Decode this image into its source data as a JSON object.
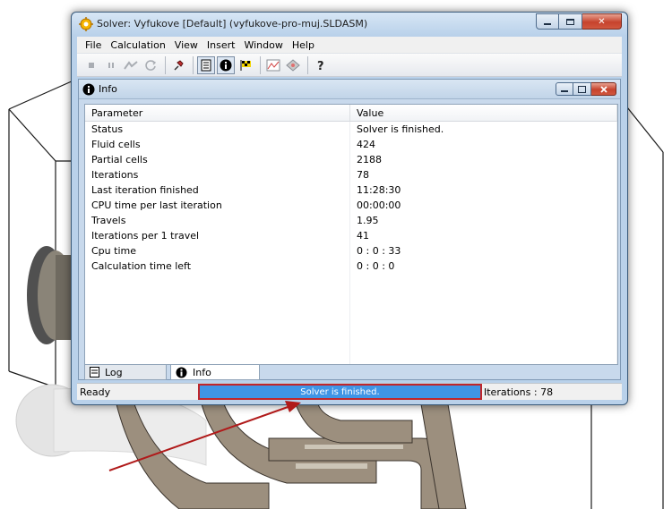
{
  "window": {
    "title": "Solver: Vyfukove [Default] (vyfukove-pro-muj.SLDASM)",
    "icon": "solver-gear-icon"
  },
  "menu": {
    "items": [
      "File",
      "Calculation",
      "View",
      "Insert",
      "Window",
      "Help"
    ]
  },
  "toolbar": {
    "buttons": [
      {
        "name": "stop-icon",
        "pressed": false
      },
      {
        "name": "pause-icon",
        "pressed": false
      },
      {
        "name": "run-icon",
        "pressed": false
      },
      {
        "name": "refresh-icon",
        "pressed": false
      },
      {
        "name": "pin-icon",
        "pressed": false
      },
      {
        "name": "log-icon",
        "pressed": true
      },
      {
        "name": "info-icon",
        "pressed": true
      },
      {
        "name": "goals-flag-icon",
        "pressed": false
      },
      {
        "name": "plot-icon",
        "pressed": false
      },
      {
        "name": "preview-icon",
        "pressed": false
      },
      {
        "name": "help-icon",
        "pressed": false
      }
    ]
  },
  "info_panel": {
    "title": "Info",
    "columns": [
      "Parameter",
      "Value"
    ],
    "rows": [
      [
        "Status",
        "Solver is finished."
      ],
      [
        "Fluid cells",
        "424"
      ],
      [
        "Partial cells",
        "2188"
      ],
      [
        "Iterations",
        "78"
      ],
      [
        "Last iteration finished",
        "11:28:30"
      ],
      [
        "CPU time per last iteration",
        "00:00:00"
      ],
      [
        "Travels",
        "1.95"
      ],
      [
        "Iterations per 1 travel",
        "41"
      ],
      [
        "Cpu time",
        "0 : 0 : 33"
      ],
      [
        "Calculation time left",
        "0 : 0 : 0"
      ]
    ],
    "tabs": [
      "Log",
      "Info"
    ]
  },
  "statusbar": {
    "ready": "Ready",
    "progress_text": "Solver is finished.",
    "progress_fraction": 1.0,
    "iterations": "Iterations : 78"
  },
  "colors": {
    "progress": "#3f95e6",
    "highlight": "#c0262b",
    "close_button": "#c6432d"
  }
}
